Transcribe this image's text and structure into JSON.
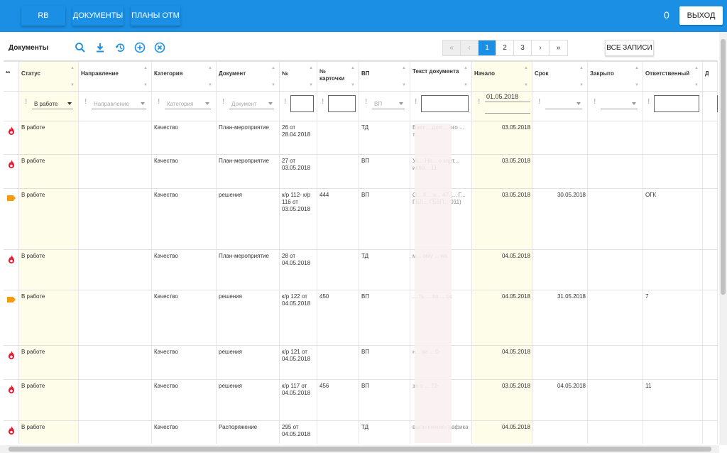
{
  "topbar": {
    "rb_label": "RB",
    "docs_label": "ДОКУМЕНТЫ",
    "plans_label": "ПЛАНЫ ОТМ",
    "counter": "0",
    "logout_label": "ВЫХОД",
    "accent": "#1a8fe3"
  },
  "toolbar": {
    "title": "Документы",
    "icons": [
      "search-icon",
      "download-icon",
      "history-icon",
      "add-circle-icon",
      "cancel-circle-icon"
    ],
    "pager": {
      "first": "«",
      "prev": "‹",
      "pages": [
        "1",
        "2",
        "3"
      ],
      "next": "›",
      "last": "»",
      "active": "1"
    },
    "all_records": "ВСЕ ЗАПИСИ"
  },
  "table": {
    "columns": [
      "***",
      "Статус",
      "Направление",
      "Категория",
      "Документ",
      "№",
      "№ карточки",
      "ВП",
      "Текст документа",
      "Начало",
      "Срок",
      "Закрыто",
      "Ответственный",
      "Дол"
    ],
    "filters": {
      "status": "В работе",
      "direction": "Направление",
      "category": "Категория",
      "document": "Документ",
      "vp": "ВП",
      "start_date": "01.05.2018"
    },
    "rows": [
      {
        "icon": "fire-icon",
        "status": "В работе",
        "category": "Качество",
        "doc": "План-мероприятие",
        "num": "26 от 28.04.2018",
        "card": "",
        "vp": "ТД",
        "text": "Внеп... для ... ого ... т...",
        "start": "03.05.2018",
        "term": "",
        "resp": ""
      },
      {
        "icon": "fire-icon",
        "status": "В работе",
        "category": "Качество",
        "doc": "План-мероприятие",
        "num": "27 от 03.05.2018",
        "card": "",
        "vp": "ВП",
        "text": "Ус... Не... о карт... испо... 11",
        "start": "03.05.2018",
        "term": "",
        "resp": ""
      },
      {
        "icon": "tag-icon",
        "status": "В работе",
        "category": "Качество",
        "doc": "решения",
        "num": "к/р 112- к/р 116 от 03.05.2018",
        "card": "444",
        "vp": "ВП",
        "text": "О... К... а... 47 (... Г... ГБЛ... ГБВП... 011)",
        "start": "03.05.2018",
        "term": "30.05.2018",
        "resp": "ОГК"
      },
      {
        "icon": "fire-icon",
        "status": "В работе",
        "category": "Качество",
        "doc": "План-мероприятие",
        "num": "28 от 04.05.2018",
        "card": "",
        "vp": "ТД",
        "text": "м... ому ... но",
        "start": "04.05.2018",
        "term": "",
        "resp": ""
      },
      {
        "icon": "tag-icon",
        "status": "В работе",
        "category": "Качество",
        "doc": "решения",
        "num": "к/р 122 от 04.05.2018",
        "card": "450",
        "vp": "ВП",
        "text": "... ть ... ва ... ок",
        "start": "04.05.2018",
        "term": "31.05.2018",
        "resp": "7"
      },
      {
        "icon": "fire-icon",
        "status": "В работе",
        "category": "Качество",
        "doc": "решения",
        "num": "к/р 121 от 04.05.2018",
        "card": "",
        "vp": "ВП",
        "text": "н... ки ... 0-",
        "start": "04.05.2018",
        "term": "",
        "resp": ""
      },
      {
        "icon": "fire-icon",
        "status": "В работе",
        "category": "Качество",
        "doc": "решения",
        "num": "к/р 117 от 04.05.2018",
        "card": "456",
        "vp": "ВП",
        "text": "за о ... 72-",
        "start": "03.05.2018",
        "term": "04.05.2018",
        "resp": "11"
      },
      {
        "icon": "fire-icon",
        "status": "В работе",
        "category": "Качество",
        "doc": "Распоряжение",
        "num": "295 от 04.05.2018",
        "card": "",
        "vp": "ТД",
        "text": "выполнения графика",
        "start": "04.05.2018",
        "term": "",
        "resp": ""
      }
    ],
    "colors": {
      "highlight": "#fdfde9",
      "fire": "#e8192c",
      "tag": "#f39c12"
    }
  }
}
